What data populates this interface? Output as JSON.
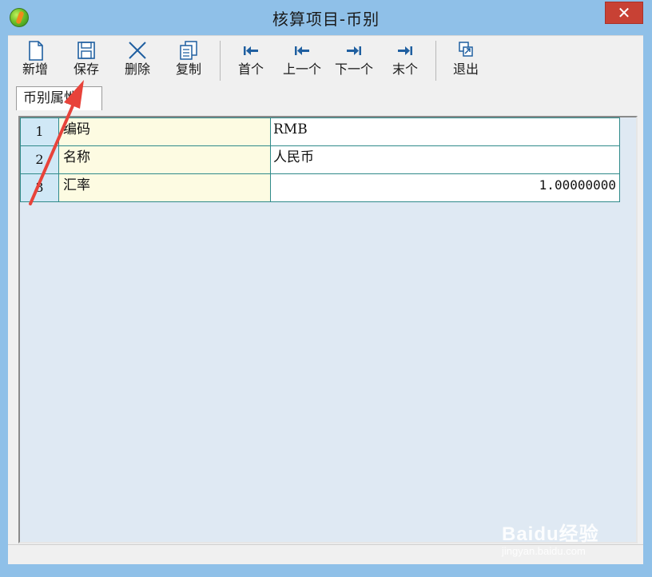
{
  "window": {
    "title": "核算项目-币别",
    "close_glyph": "✕"
  },
  "toolbar": {
    "buttons": [
      {
        "label": "新增",
        "icon": "new-doc-icon"
      },
      {
        "label": "保存",
        "icon": "save-icon"
      },
      {
        "label": "删除",
        "icon": "delete-icon"
      },
      {
        "label": "复制",
        "icon": "copy-icon"
      },
      {
        "label": "首个",
        "icon": "first-record-icon"
      },
      {
        "label": "上一个",
        "icon": "prev-record-icon"
      },
      {
        "label": "下一个",
        "icon": "next-record-icon"
      },
      {
        "label": "末个",
        "icon": "last-record-icon"
      },
      {
        "label": "退出",
        "icon": "exit-icon"
      }
    ]
  },
  "tabs": [
    {
      "label": "币别属性"
    }
  ],
  "grid": {
    "rows": [
      {
        "num": "1",
        "name": "编码",
        "value": "RMB"
      },
      {
        "num": "2",
        "name": "名称",
        "value": "人民币"
      },
      {
        "num": "3",
        "name": "汇率",
        "value": "1.00000000"
      }
    ]
  },
  "watermark": {
    "brand": "Baidu经验",
    "sub": "jingyan.baidu.com"
  },
  "colors": {
    "titlebar": "#8fc0e8",
    "close": "#c84134",
    "arrow": "#e8433a",
    "grid_border": "#2f8a8a"
  }
}
